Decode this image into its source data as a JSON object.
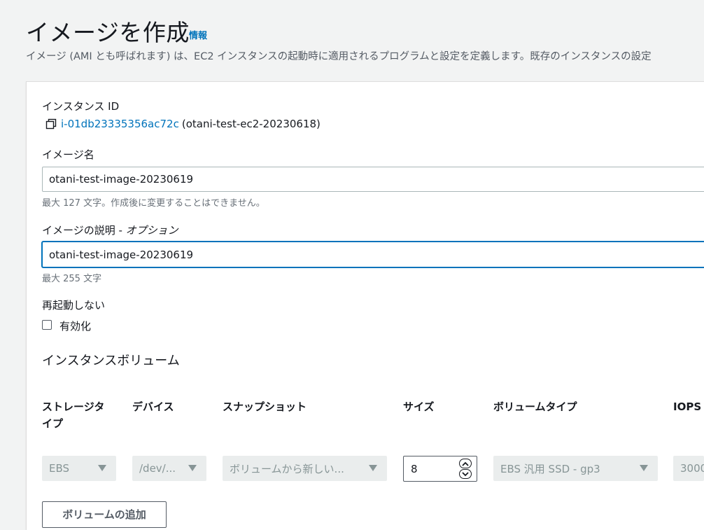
{
  "header": {
    "title": "イメージを作成",
    "info_link": "情報",
    "description": "イメージ (AMI とも呼ばれます) は、EC2 インスタンスの起動時に適用されるプログラムと設定を定義します。既存のインスタンスの設定"
  },
  "instance": {
    "label": "インスタンス ID",
    "id": "i-01db23335356ac72c",
    "name": "(otani-test-ec2-20230618)"
  },
  "image_name": {
    "label": "イメージ名",
    "value": "otani-test-image-20230619",
    "hint": "最大 127 文字。作成後に変更することはできません。"
  },
  "image_description": {
    "label": "イメージの説明 - ",
    "label_optional": "オプション",
    "value": "otani-test-image-20230619",
    "hint": "最大 255 文字"
  },
  "no_reboot": {
    "label": "再起動しない",
    "checkbox_label": "有効化",
    "checked": false
  },
  "volumes": {
    "title": "インスタンスボリューム",
    "columns": [
      "ストレージタ\nイプ",
      "デバイス",
      "スナップショット",
      "サイズ",
      "ボリュームタイプ",
      "IOPS"
    ],
    "row": {
      "storage_type": "EBS",
      "device": "/dev/...",
      "snapshot": "ボリュームから新しい...",
      "size": "8",
      "volume_type": "EBS 汎用 SSD - gp3",
      "iops": "3000"
    },
    "add_button": "ボリュームの追加"
  },
  "colors": {
    "link": "#0073bb",
    "focus_border": "#0073bb",
    "background": "#f2f3f3",
    "disabled_select": "#eaeded"
  },
  "icons": [
    "copy-icon",
    "caret-down-icon",
    "chevron-up-icon",
    "chevron-down-icon"
  ]
}
